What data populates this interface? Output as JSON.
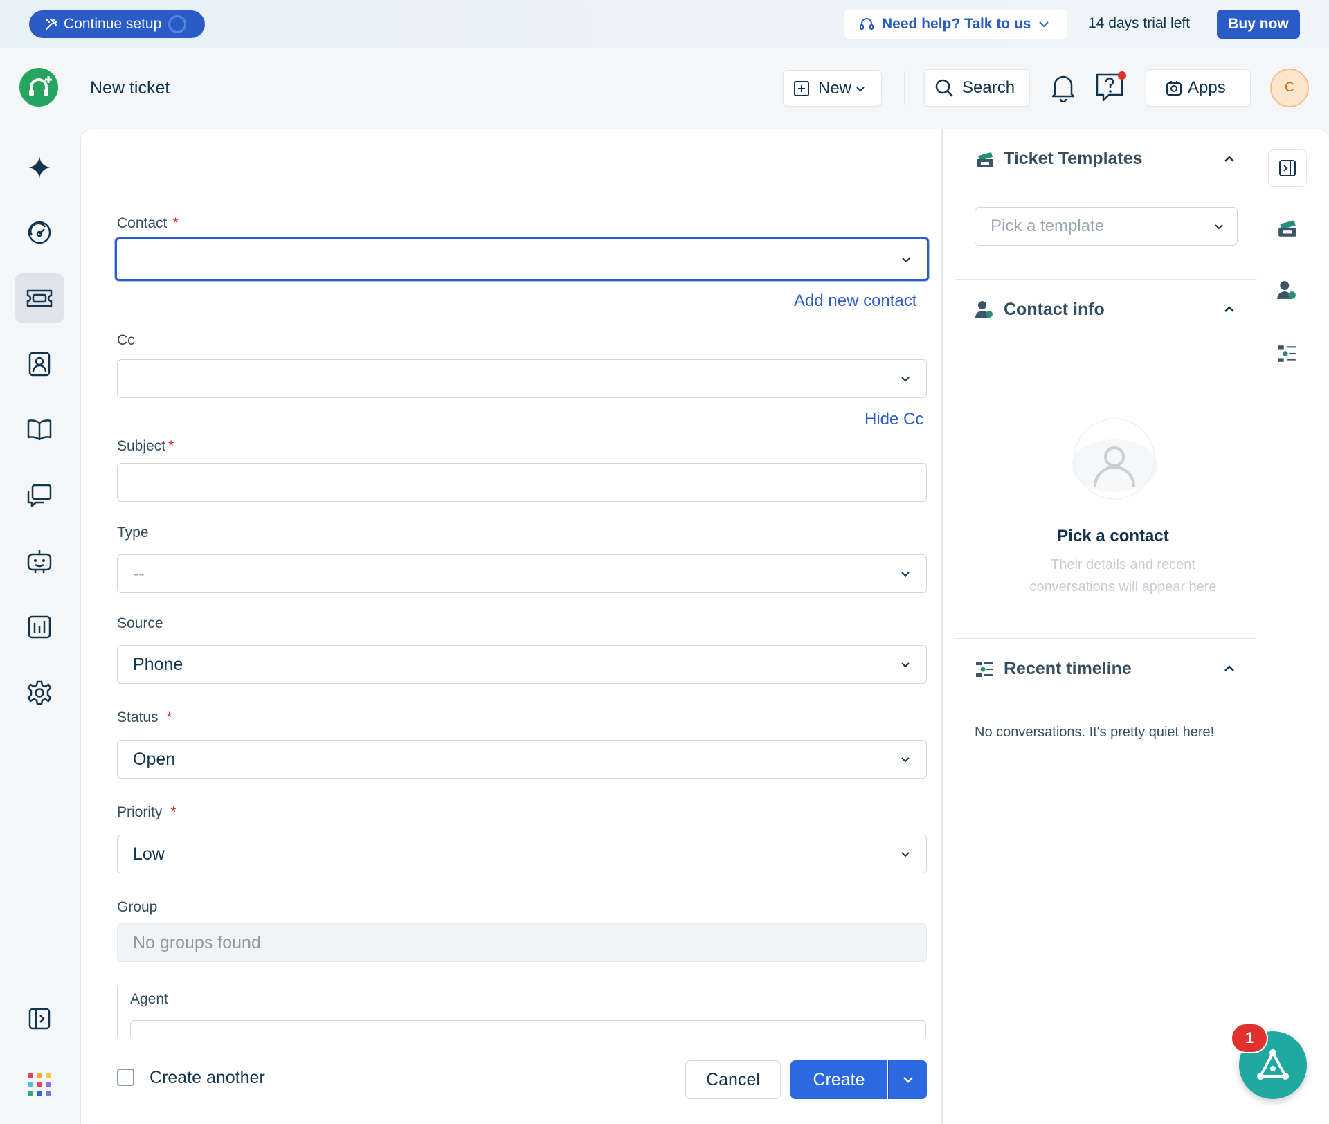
{
  "banner": {
    "setup_label": "Continue setup",
    "help_label": "Need help? Talk to us",
    "trial_text": "14 days trial left",
    "buy_label": "Buy now"
  },
  "header": {
    "page_title": "New ticket",
    "new_label": "New",
    "search_label": "Search",
    "apps_label": "Apps",
    "avatar_initial": "C"
  },
  "nav": {
    "items": [
      "sparkle-icon",
      "dashboard-icon",
      "tickets-icon",
      "contacts-icon",
      "knowledge-base-icon",
      "conversations-icon",
      "bot-icon",
      "reports-icon",
      "settings-icon"
    ],
    "active": "tickets-icon"
  },
  "form": {
    "contact": {
      "label": "Contact",
      "value": "",
      "add_link": "Add new contact"
    },
    "cc": {
      "label": "Cc",
      "value": "",
      "hide_link": "Hide Cc"
    },
    "subject": {
      "label": "Subject",
      "value": ""
    },
    "type": {
      "label": "Type",
      "value": "--"
    },
    "source": {
      "label": "Source",
      "value": "Phone"
    },
    "status": {
      "label": "Status",
      "value": "Open"
    },
    "priority": {
      "label": "Priority",
      "value": "Low"
    },
    "group": {
      "label": "Group",
      "value": "No groups found"
    },
    "agent": {
      "label": "Agent"
    },
    "required_mark": "*"
  },
  "footer": {
    "create_another_label": "Create another",
    "cancel_label": "Cancel",
    "create_label": "Create"
  },
  "side": {
    "templates": {
      "title": "Ticket Templates",
      "placeholder": "Pick a template"
    },
    "contact_info": {
      "title": "Contact info",
      "empty_title": "Pick a contact",
      "empty_sub": "Their details and recent conversations will appear here"
    },
    "timeline": {
      "title": "Recent timeline",
      "empty": "No conversations. It's pretty quiet here!"
    }
  },
  "fab": {
    "badge": "1"
  },
  "colors": {
    "primary": "#2c68e0",
    "brand_green": "#25a55f",
    "required": "#d72d30",
    "fab": "#1fa9a0"
  }
}
